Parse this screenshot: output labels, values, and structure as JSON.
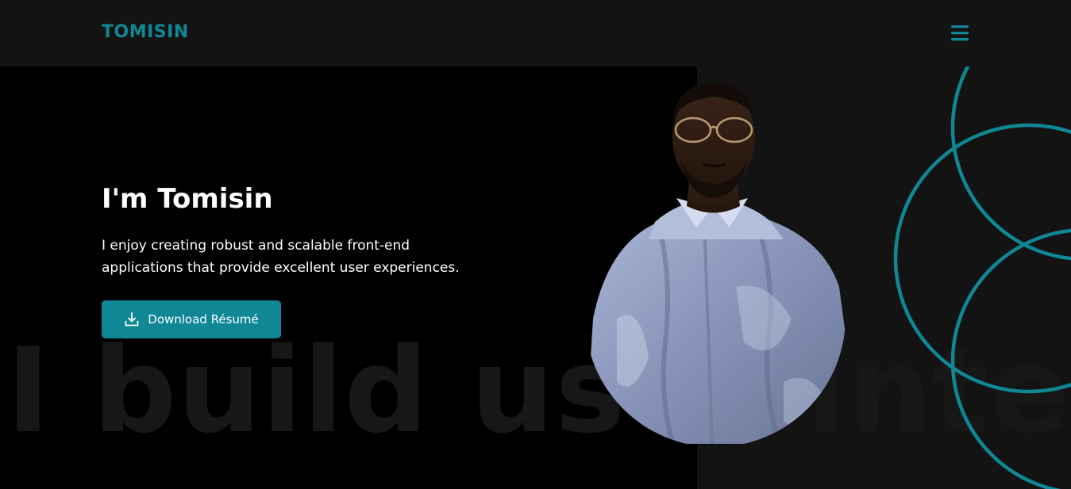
{
  "header": {
    "logo": "TOMISIN",
    "menu_icon": "hamburger-menu-icon"
  },
  "hero": {
    "title": "I'm Tomisin",
    "description": "I enjoy creating robust and scalable front-end applications that provide excellent user experiences.",
    "download_button": {
      "label": "Download Résumé",
      "icon": "download-icon"
    },
    "background_text": "I build user interfaces"
  },
  "colors": {
    "accent": "#0f8795",
    "background": "#000000",
    "navbar": "#131313",
    "right_panel": "#131313",
    "text": "#ffffff"
  }
}
